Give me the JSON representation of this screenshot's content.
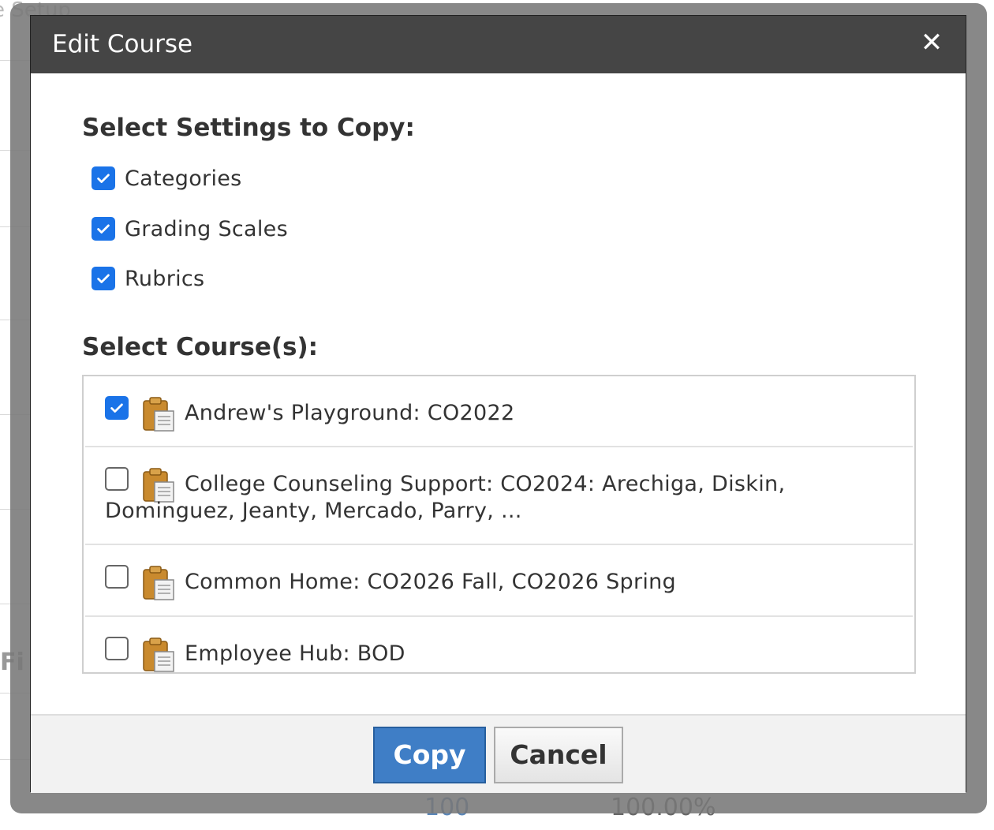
{
  "background": {
    "title_fragment": "e Setup",
    "side_fragment": "Fi",
    "bottom_value_1": "100",
    "bottom_value_2": "100.00%"
  },
  "dialog": {
    "title": "Edit Course",
    "close_icon": "close-icon",
    "settings_heading": "Select Settings to Copy:",
    "settings": [
      {
        "label": "Categories",
        "checked": true
      },
      {
        "label": "Grading Scales",
        "checked": true
      },
      {
        "label": "Rubrics",
        "checked": true
      }
    ],
    "courses_heading": "Select Course(s):",
    "courses": [
      {
        "label": "Andrew's Playground: CO2022",
        "checked": true,
        "icon": "clipboard-icon"
      },
      {
        "label": "College Counseling Support: CO2024: Arechiga, Diskin, Dominguez, Jeanty, Mercado, Parry, ...",
        "checked": false,
        "icon": "clipboard-icon"
      },
      {
        "label": "Common Home: CO2026 Fall, CO2026 Spring",
        "checked": false,
        "icon": "clipboard-icon"
      },
      {
        "label": "Employee Hub: BOD",
        "checked": false,
        "icon": "clipboard-icon"
      }
    ],
    "buttons": {
      "copy": "Copy",
      "cancel": "Cancel"
    }
  },
  "colors": {
    "header_bg": "#454545",
    "checkbox_checked": "#1a73e8",
    "copy_button": "#3f7ec6"
  }
}
